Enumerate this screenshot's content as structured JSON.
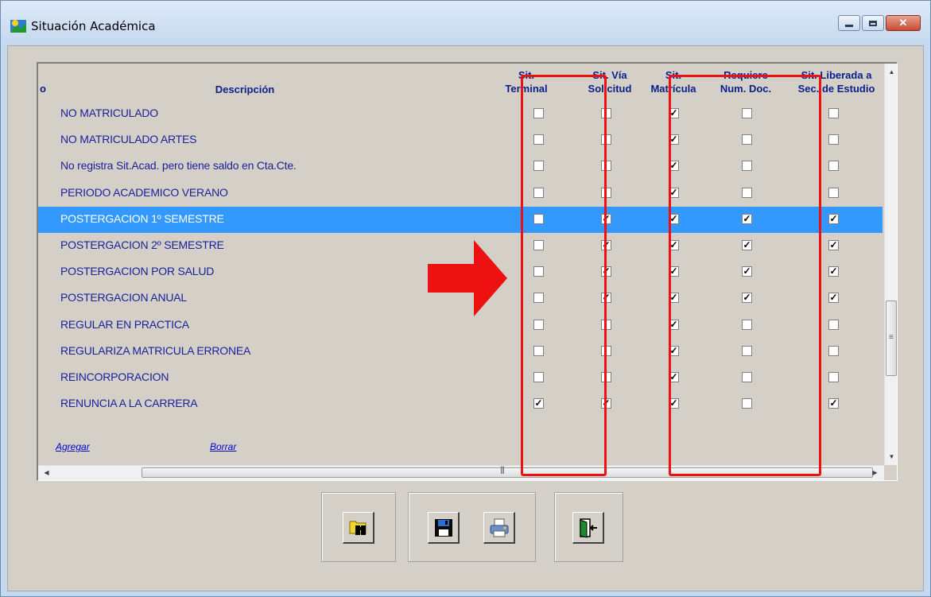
{
  "window": {
    "title": "Situación Académica"
  },
  "grid": {
    "headers": {
      "code": "o",
      "description": "Descripción",
      "sit_terminal": [
        "Sit.",
        "Terminal"
      ],
      "sit_via_solicitud": [
        "Sit. Vía",
        "Solicitud"
      ],
      "sit_matricula": [
        "Sit.",
        "Matrícula"
      ],
      "requiere_num_doc": [
        "Requiere",
        "Num. Doc."
      ],
      "sit_liberada": [
        "Sit. Liberada a",
        "Sec. de Estudio"
      ]
    },
    "rows": [
      {
        "description": "NO MATRICULADO",
        "checks": [
          false,
          false,
          true,
          false,
          false
        ],
        "selected": false
      },
      {
        "description": "NO MATRICULADO ARTES",
        "checks": [
          false,
          false,
          true,
          false,
          false
        ],
        "selected": false
      },
      {
        "description": "No registra Sit.Acad. pero tiene saldo en Cta.Cte.",
        "checks": [
          false,
          false,
          true,
          false,
          false
        ],
        "selected": false
      },
      {
        "description": "PERIODO ACADEMICO VERANO",
        "checks": [
          false,
          false,
          true,
          false,
          false
        ],
        "selected": false
      },
      {
        "description": "POSTERGACION   1º SEMESTRE",
        "checks": [
          false,
          true,
          true,
          true,
          true
        ],
        "selected": true
      },
      {
        "description": "POSTERGACION   2º SEMESTRE",
        "checks": [
          false,
          true,
          true,
          true,
          true
        ],
        "selected": false
      },
      {
        "description": "POSTERGACION  POR  SALUD",
        "checks": [
          false,
          true,
          true,
          true,
          true
        ],
        "selected": false
      },
      {
        "description": "POSTERGACION ANUAL",
        "checks": [
          false,
          true,
          true,
          true,
          true
        ],
        "selected": false
      },
      {
        "description": "REGULAR EN PRACTICA",
        "checks": [
          false,
          false,
          true,
          false,
          false
        ],
        "selected": false
      },
      {
        "description": "REGULARIZA MATRICULA ERRONEA",
        "checks": [
          false,
          false,
          true,
          false,
          false
        ],
        "selected": false
      },
      {
        "description": "REINCORPORACION",
        "checks": [
          false,
          false,
          true,
          false,
          false
        ],
        "selected": false
      },
      {
        "description": "RENUNCIA A LA CARRERA",
        "checks": [
          true,
          true,
          true,
          false,
          true
        ],
        "selected": false
      }
    ],
    "links": {
      "add": "Agregar",
      "delete": "Borrar"
    }
  },
  "toolbar": {
    "icons": [
      "search-folder-icon",
      "save-icon",
      "print-icon",
      "exit-door-icon"
    ]
  },
  "colors": {
    "selection": "#3399ff",
    "highlight": "#ee1111",
    "text": "#1a1f9a"
  }
}
